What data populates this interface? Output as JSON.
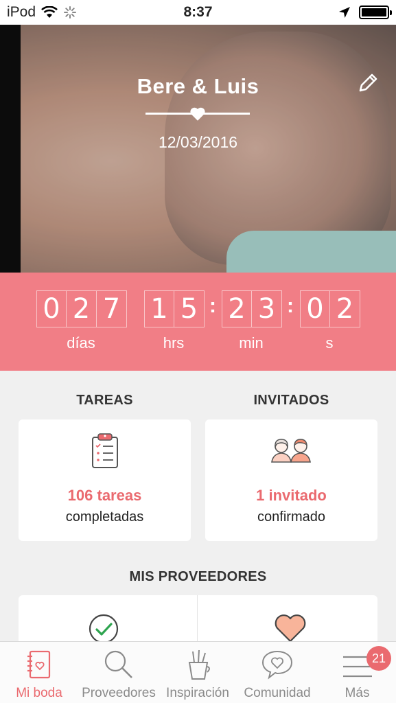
{
  "status_bar": {
    "carrier": "iPod",
    "time": "8:37"
  },
  "hero": {
    "couple": "Bere & Luis",
    "date": "12/03/2016"
  },
  "countdown": {
    "days": [
      "0",
      "2",
      "7"
    ],
    "hours": [
      "1",
      "5"
    ],
    "minutes": [
      "2",
      "3"
    ],
    "seconds": [
      "0",
      "2"
    ],
    "labels": {
      "days": "días",
      "hours": "hrs",
      "minutes": "min",
      "seconds": "s"
    }
  },
  "tasks": {
    "title": "TAREAS",
    "count": "106 tareas",
    "sub": "completadas"
  },
  "guests": {
    "title": "INVITADOS",
    "count": "1 invitado",
    "sub": "confirmado"
  },
  "vendors": {
    "title": "MIS PROVEEDORES"
  },
  "tabbar": {
    "items": [
      {
        "label": "Mi boda",
        "icon": "notebook-icon"
      },
      {
        "label": "Proveedores",
        "icon": "search-icon"
      },
      {
        "label": "Inspiración",
        "icon": "pencil-cup-icon"
      },
      {
        "label": "Comunidad",
        "icon": "chat-heart-icon"
      },
      {
        "label": "Más",
        "icon": "menu-icon"
      }
    ],
    "badge": "21"
  },
  "colors": {
    "accent": "#ea6a6f",
    "countdown_bg": "#f17e86"
  }
}
